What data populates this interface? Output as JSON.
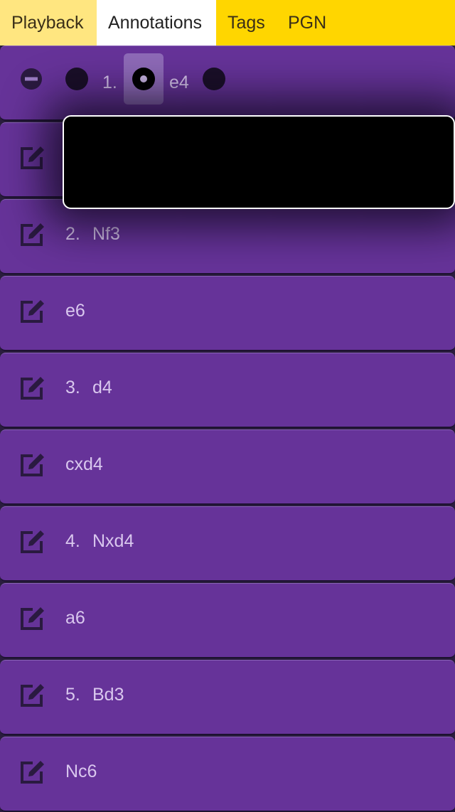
{
  "tabs": [
    {
      "label": "Playback"
    },
    {
      "label": "Annotations"
    },
    {
      "label": "Tags"
    },
    {
      "label": "PGN"
    }
  ],
  "expanded_row": {
    "move_no": "1.",
    "san": "e4"
  },
  "moves": [
    {
      "no": "",
      "san": ""
    },
    {
      "no": "2.",
      "san": "Nf3"
    },
    {
      "no": "",
      "san": "e6"
    },
    {
      "no": "3.",
      "san": "d4"
    },
    {
      "no": "",
      "san": "cxd4"
    },
    {
      "no": "4.",
      "san": "Nxd4"
    },
    {
      "no": "",
      "san": "a6"
    },
    {
      "no": "5.",
      "san": "Bd3"
    },
    {
      "no": "",
      "san": "Nc6"
    }
  ],
  "colors": {
    "tabbar": "#ffd600",
    "row": "#663399",
    "accent": "#1a0f28"
  }
}
